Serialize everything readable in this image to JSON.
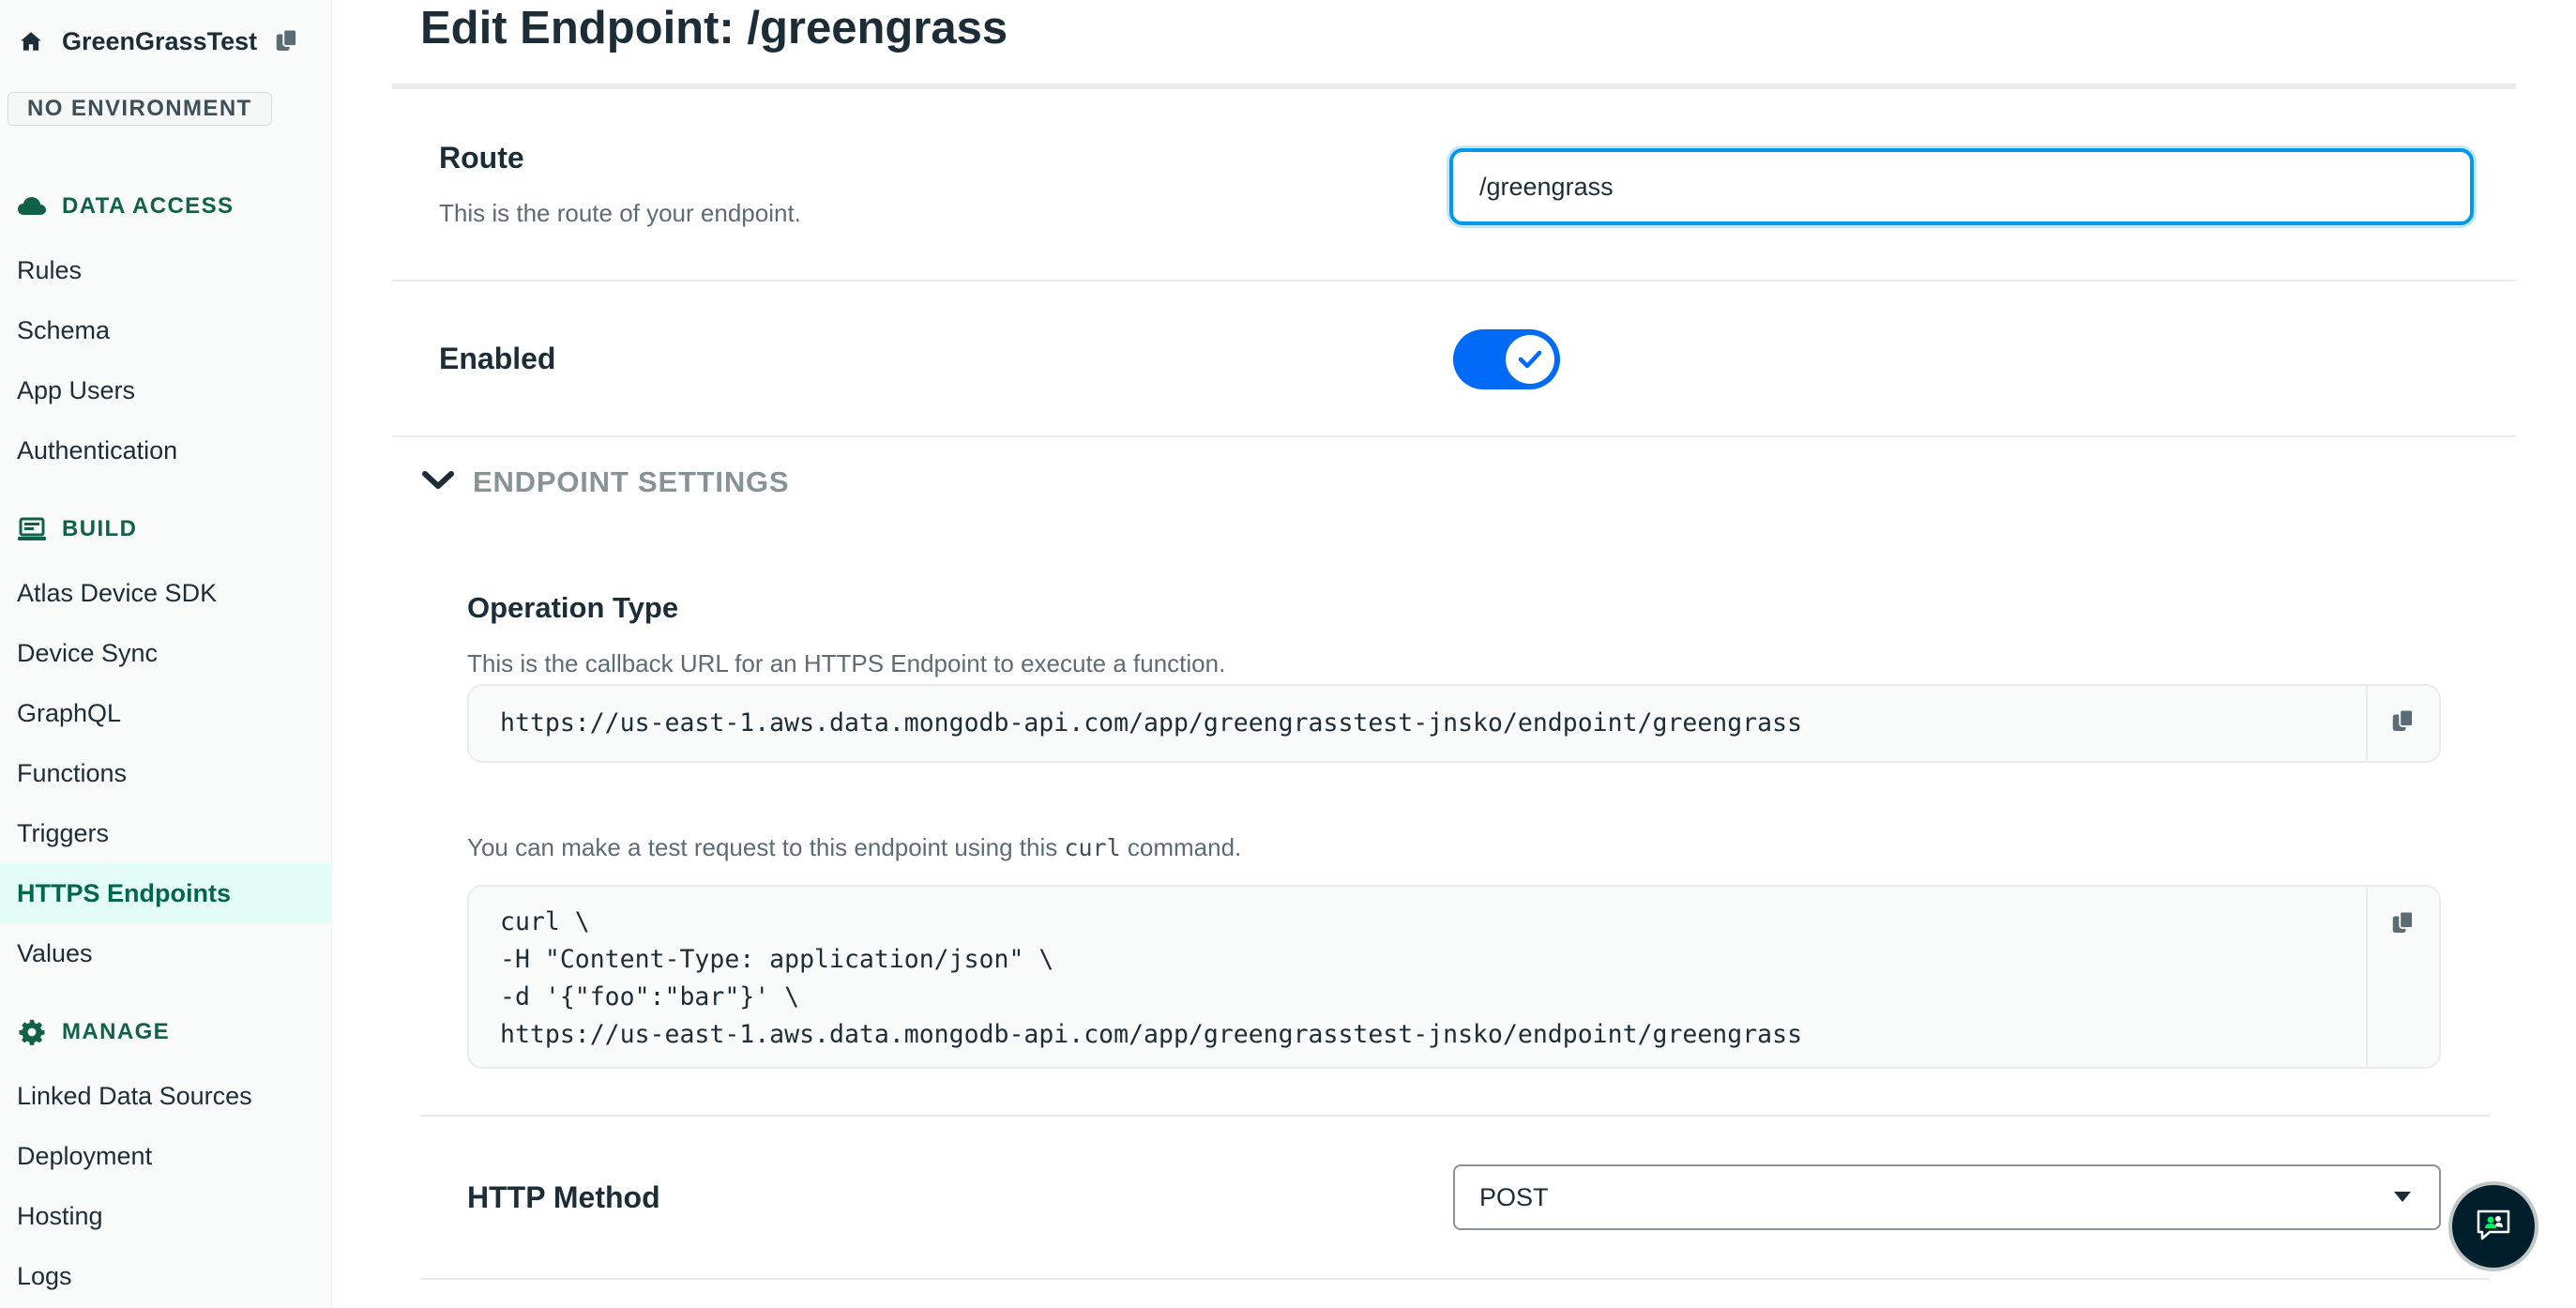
{
  "sidebar": {
    "app_name": "GreenGrassTest",
    "environment_badge": "NO ENVIRONMENT",
    "sections": [
      {
        "label": "DATA ACCESS",
        "icon": "cloud-icon",
        "items": [
          "Rules",
          "Schema",
          "App Users",
          "Authentication"
        ]
      },
      {
        "label": "BUILD",
        "icon": "laptop-icon",
        "items": [
          "Atlas Device SDK",
          "Device Sync",
          "GraphQL",
          "Functions",
          "Triggers",
          "HTTPS Endpoints",
          "Values"
        ]
      },
      {
        "label": "MANAGE",
        "icon": "gear-icon",
        "items": [
          "Linked Data Sources",
          "Deployment",
          "Hosting",
          "Logs"
        ]
      }
    ],
    "active_item": "HTTPS Endpoints"
  },
  "page": {
    "title": "Edit Endpoint: /greengrass"
  },
  "route": {
    "label": "Route",
    "description": "This is the route of your endpoint.",
    "value": "/greengrass"
  },
  "enabled": {
    "label": "Enabled",
    "value": true
  },
  "endpoint_settings": {
    "header": "ENDPOINT SETTINGS",
    "expanded": true,
    "operation_type": {
      "label": "Operation Type",
      "description": "This is the callback URL for an HTTPS Endpoint to execute a function.",
      "url": "https://us-east-1.aws.data.mongodb-api.com/app/greengrasstest-jnsko/endpoint/greengrass"
    },
    "curl": {
      "description_before": "You can make a test request to this endpoint using this ",
      "description_code": "curl",
      "description_after": " command.",
      "lines": [
        "curl \\",
        "-H \"Content-Type: application/json\" \\",
        "-d '{\"foo\":\"bar\"}' \\",
        "https://us-east-1.aws.data.mongodb-api.com/app/greengrasstest-jnsko/endpoint/greengrass"
      ]
    },
    "http_method": {
      "label": "HTTP Method",
      "selected": "POST"
    }
  },
  "colors": {
    "accent_green": "#116149",
    "toggle_blue": "#016bf8",
    "focus_blue": "#0498ec",
    "active_bg": "#e3fcf7"
  }
}
